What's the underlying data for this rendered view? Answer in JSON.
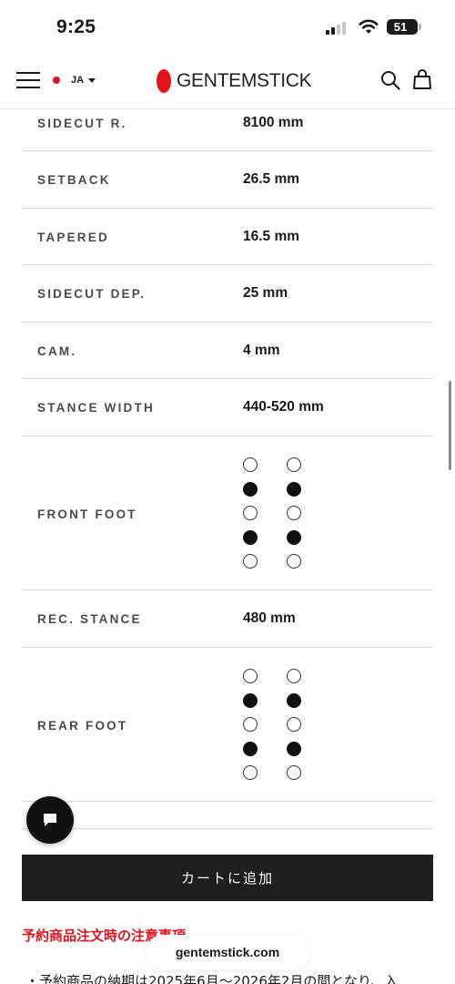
{
  "status_bar": {
    "time": "9:25",
    "battery": "51",
    "icons": [
      "signal-icon",
      "wifi-icon",
      "battery-icon"
    ]
  },
  "header": {
    "language": "JA",
    "logo_text": "GENTEMSTICK",
    "icons": [
      "menu-icon",
      "search-icon",
      "bag-icon"
    ]
  },
  "specs": [
    {
      "label": "SIDECUT R.",
      "value": "8100 mm"
    },
    {
      "label": "SETBACK",
      "value": "26.5 mm"
    },
    {
      "label": "TAPERED",
      "value": "16.5 mm"
    },
    {
      "label": "SIDECUT DEP.",
      "value": "25 mm"
    },
    {
      "label": "CAM.",
      "value": "4 mm"
    },
    {
      "label": "STANCE WIDTH",
      "value": "440-520 mm"
    },
    {
      "label": "FRONT FOOT",
      "pattern": [
        false,
        true,
        false,
        true,
        false
      ]
    },
    {
      "label": "REC. STANCE",
      "value": "480 mm"
    },
    {
      "label": "REAR FOOT",
      "pattern": [
        false,
        true,
        false,
        true,
        false
      ]
    }
  ],
  "chat_button": {
    "icon": "chat-icon"
  },
  "cart_button": {
    "label": "カートに追加"
  },
  "notice": {
    "heading": "予約商品注文時の注意事項",
    "first_line": "・予約商品の納期は2025年6月〜2026年2月の間となり、入"
  },
  "browser": {
    "url": "gentemstick.com"
  },
  "colors": {
    "brand_red": "#e3131b",
    "notice_red": "#e0121b",
    "button_bg": "#1e1e1e"
  }
}
